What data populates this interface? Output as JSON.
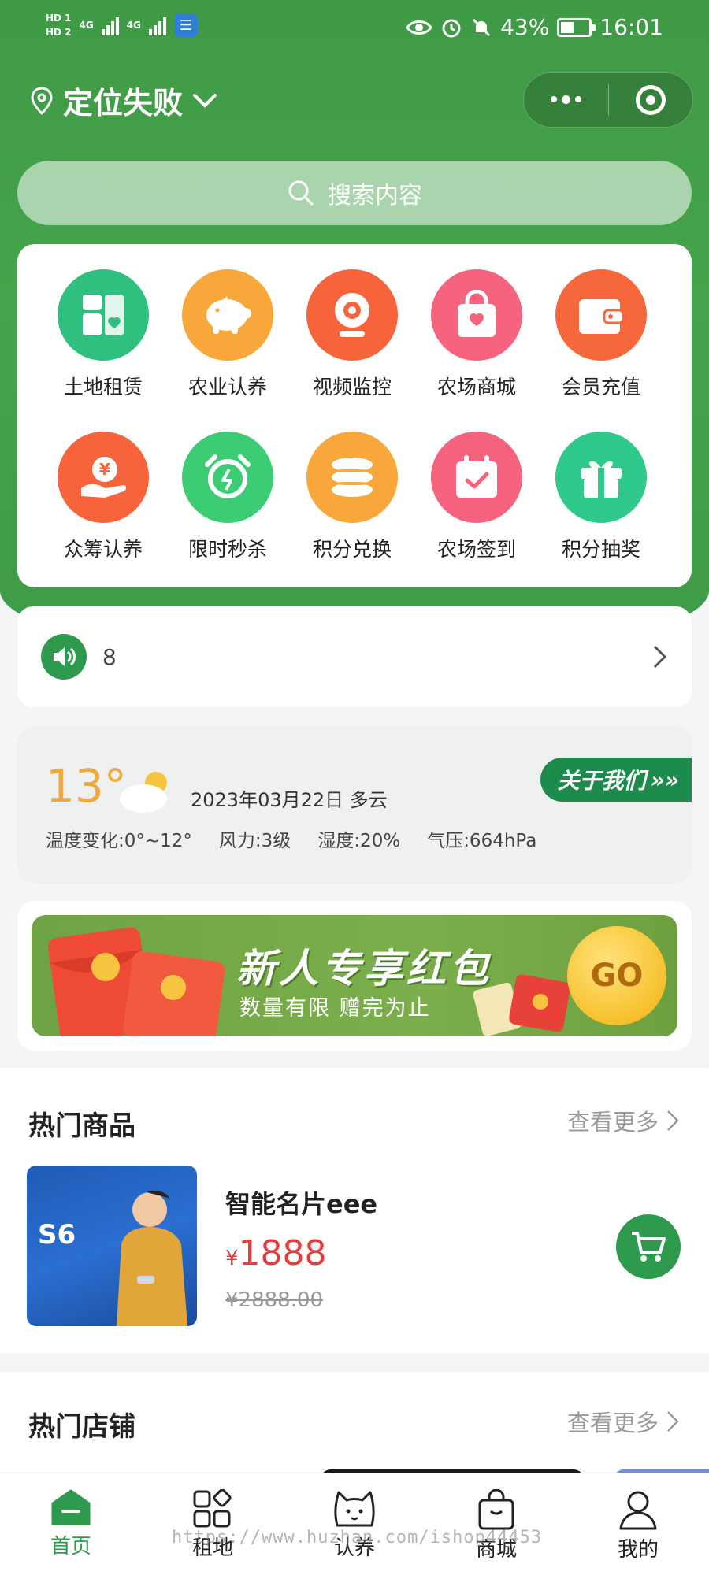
{
  "status_bar": {
    "hd1": "HD 1",
    "hd2": "HD 2",
    "net1": "4G",
    "net2": "4G",
    "battery": "43%",
    "time": "16:01"
  },
  "nav": {
    "location": "定位失败"
  },
  "search": {
    "placeholder": "搜索内容"
  },
  "grid": {
    "items": [
      {
        "label": "土地租赁",
        "color": "#2fbf7e",
        "icon": "land-icon"
      },
      {
        "label": "农业认养",
        "color": "#f8a83b",
        "icon": "piggy-icon"
      },
      {
        "label": "视频监控",
        "color": "#f7643c",
        "icon": "camera-icon"
      },
      {
        "label": "农场商城",
        "color": "#f5637e",
        "icon": "shopping-bag-icon"
      },
      {
        "label": "会员充值",
        "color": "#f7673c",
        "icon": "wallet-icon"
      },
      {
        "label": "众筹认养",
        "color": "#f7643c",
        "icon": "yuan-hand-icon"
      },
      {
        "label": "限时秒杀",
        "color": "#3ccd74",
        "icon": "alarm-clock-icon"
      },
      {
        "label": "积分兑换",
        "color": "#f8a83b",
        "icon": "coins-icon"
      },
      {
        "label": "农场签到",
        "color": "#f5637e",
        "icon": "calendar-check-icon"
      },
      {
        "label": "积分抽奖",
        "color": "#2fc98b",
        "icon": "gift-icon"
      }
    ]
  },
  "notice": {
    "text": "8"
  },
  "weather": {
    "temp": "13°",
    "date_desc": "2023年03月22日 多云",
    "temp_range": "温度变化:0°~12°",
    "wind": "风力:3级",
    "humidity": "湿度:20%",
    "pressure": "气压:664hPa",
    "about_label": "关于我们"
  },
  "banner": {
    "title": "新人专享红包",
    "subtitle": "数量有限 赠完为止",
    "go_label": "GO"
  },
  "hot_products": {
    "title": "热门商品",
    "more_label": "查看更多",
    "items": [
      {
        "name": "智能名片eee",
        "currency": "¥",
        "price": "1888",
        "old_price": "¥2888.00",
        "image_text": "S6"
      }
    ]
  },
  "hot_stores": {
    "title": "热门店铺",
    "more_label": "查看更多"
  },
  "tabbar": {
    "items": [
      {
        "label": "首页",
        "active": true
      },
      {
        "label": "租地",
        "active": false
      },
      {
        "label": "认养",
        "active": false
      },
      {
        "label": "商城",
        "active": false
      },
      {
        "label": "我的",
        "active": false
      }
    ]
  },
  "watermark": "https://www.huzhan.com/ishop44453",
  "colors": {
    "primary_green": "#2e9a4e",
    "header_green": "#43a048",
    "price_red": "#e53b3b"
  }
}
